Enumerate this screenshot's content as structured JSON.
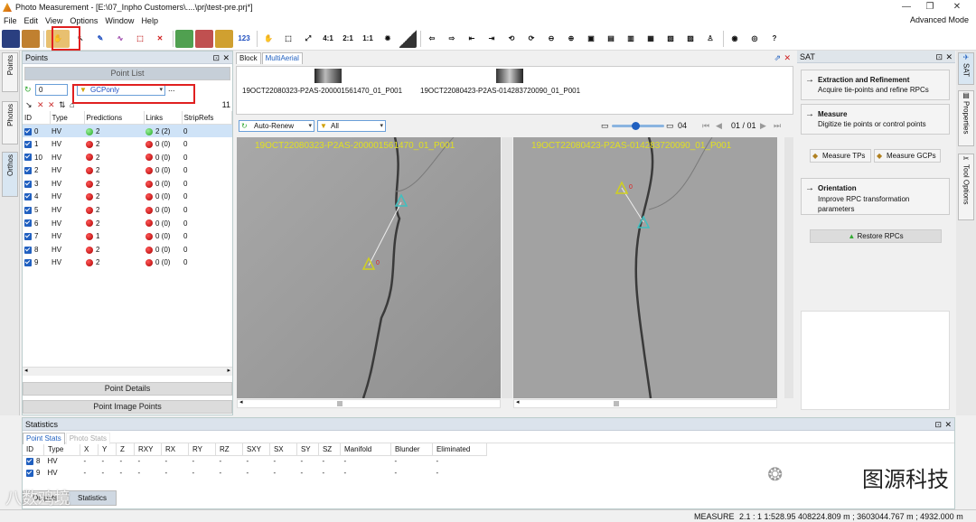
{
  "window": {
    "title": "Photo Measurement - [E:\\07_Inpho Customers\\....\\prj\\test-pre.prj*]",
    "mode": "Advanced Mode"
  },
  "menu": [
    "File",
    "Edit",
    "View",
    "Options",
    "Window",
    "Help"
  ],
  "toolbar": {
    "ratios": [
      "4:1",
      "2:1",
      "1:1"
    ],
    "numbering": "123"
  },
  "points_panel": {
    "title": "Points",
    "point_list_tab": "Point List",
    "counter": "0",
    "filter": "GCPonly",
    "more": "...",
    "total": "11",
    "columns": [
      "ID",
      "Type",
      "Predictions",
      "Links",
      "StripRefs"
    ],
    "rows": [
      {
        "id": "0",
        "type": "HV",
        "pred": "2",
        "pred_color": "green",
        "links": "2 (2)",
        "link_color": "green",
        "strip": "0"
      },
      {
        "id": "1",
        "type": "HV",
        "pred": "2",
        "pred_color": "red",
        "links": "0 (0)",
        "link_color": "red",
        "strip": "0"
      },
      {
        "id": "10",
        "type": "HV",
        "pred": "2",
        "pred_color": "red",
        "links": "0 (0)",
        "link_color": "red",
        "strip": "0"
      },
      {
        "id": "2",
        "type": "HV",
        "pred": "2",
        "pred_color": "red",
        "links": "0 (0)",
        "link_color": "red",
        "strip": "0"
      },
      {
        "id": "3",
        "type": "HV",
        "pred": "2",
        "pred_color": "red",
        "links": "0 (0)",
        "link_color": "red",
        "strip": "0"
      },
      {
        "id": "4",
        "type": "HV",
        "pred": "2",
        "pred_color": "red",
        "links": "0 (0)",
        "link_color": "red",
        "strip": "0"
      },
      {
        "id": "5",
        "type": "HV",
        "pred": "2",
        "pred_color": "red",
        "links": "0 (0)",
        "link_color": "red",
        "strip": "0"
      },
      {
        "id": "6",
        "type": "HV",
        "pred": "2",
        "pred_color": "red",
        "links": "0 (0)",
        "link_color": "red",
        "strip": "0"
      },
      {
        "id": "7",
        "type": "HV",
        "pred": "1",
        "pred_color": "red",
        "links": "0 (0)",
        "link_color": "red",
        "strip": "0"
      },
      {
        "id": "8",
        "type": "HV",
        "pred": "2",
        "pred_color": "red",
        "links": "0 (0)",
        "link_color": "red",
        "strip": "0"
      },
      {
        "id": "9",
        "type": "HV",
        "pred": "2",
        "pred_color": "red",
        "links": "0 (0)",
        "link_color": "red",
        "strip": "0"
      }
    ],
    "point_details": "Point Details",
    "point_image_points": "Point Image Points",
    "side_tabs": [
      "Points",
      "Photos",
      "Orthos"
    ]
  },
  "center_panel": {
    "tabs": [
      "Block",
      "MultiAerial"
    ],
    "thumbs": [
      "19OCT22080323-P2AS-200001561470_01_P001",
      "19OCT22080423-P2AS-014283720090_01_P001"
    ],
    "auto_renew": "Auto-Renew",
    "filter_all": "All",
    "slider_value": "04",
    "page": "01 / 01",
    "viewer_left_label": "19OCT22080323-P2AS-200001561470_01_P001",
    "viewer_right_label": "19OCT22080423-P2AS-014283720090_01_P001",
    "marker_label": "0"
  },
  "sat_panel": {
    "title": "SAT",
    "extraction_title": "Extraction and Refinement",
    "extraction_desc": "Acquire tie-points and refine RPCs",
    "measure_title": "Measure",
    "measure_desc": "Digitize tie points or control points",
    "measure_tps": "Measure TPs",
    "measure_gcps": "Measure GCPs",
    "orientation_title": "Orientation",
    "orientation_desc": "Improve RPC transformation parameters",
    "restore": "Restore RPCs",
    "side_tabs": [
      "SAT",
      "Properties",
      "Tool Options"
    ]
  },
  "stats_panel": {
    "title": "Statistics",
    "tabs": [
      "Point Stats",
      "Photo Stats"
    ],
    "columns": [
      "ID",
      "Type",
      "X",
      "Y",
      "Z",
      "RXY",
      "RX",
      "RY",
      "RZ",
      "SXY",
      "SX",
      "SY",
      "SZ",
      "Manifold",
      "Blunder",
      "Eliminated"
    ],
    "rows": [
      {
        "id": "8",
        "type": "HV",
        "vals": [
          "-",
          "-",
          "-",
          "-",
          "-",
          "-",
          "-",
          "-",
          "-",
          "-",
          "-"
        ],
        "manifold": "-",
        "blunder": "-",
        "elim": "-"
      },
      {
        "id": "9",
        "type": "HV",
        "vals": [
          "-",
          "-",
          "-",
          "-",
          "-",
          "-",
          "-",
          "-",
          "-",
          "-",
          "-"
        ],
        "manifold": "-",
        "blunder": "-",
        "elim": "-"
      }
    ],
    "bottom_tabs": [
      "Outputs",
      "Statistics"
    ]
  },
  "statusbar": {
    "mode": "MEASURE",
    "coords": "2.1 : 1  1:528.95  408224.809 m ; 3603044.767 m ; 4932.000 m"
  },
  "watermark": {
    "left": "八数鸡境",
    "right": "图源科技"
  }
}
